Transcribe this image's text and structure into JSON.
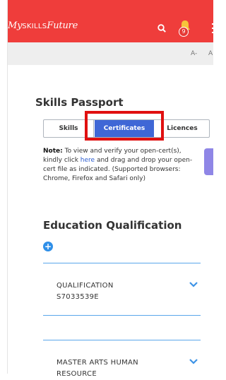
{
  "header": {
    "logo_prefix": "My",
    "logo_middle": "SKILLS",
    "logo_suffix": "Future",
    "notification_count": "9"
  },
  "font_controls": {
    "decrease": "A-",
    "increase": "A"
  },
  "page": {
    "title": "Skills Passport"
  },
  "tabs": [
    {
      "label": "Skills"
    },
    {
      "label": "Certificates",
      "active": true
    },
    {
      "label": "Licences"
    }
  ],
  "note": {
    "bold": "Note:",
    "part1": " To view and verify your open-cert(s), kindly click ",
    "link": "here",
    "part2": " and drag and drop your open-cert file as indicated. (Supported browsers: Chrome, Firefox and Safari only)"
  },
  "education": {
    "title": "Education Qualification",
    "add_symbol": "+",
    "items": [
      {
        "line1": "QUALIFICATION",
        "line2": "S7033539E"
      },
      {
        "line1": "MASTER ARTS HUMAN",
        "line2": "RESOURCE"
      }
    ]
  },
  "colors": {
    "brand": "#ef3d3b",
    "tab_active": "#3f67d6",
    "accent": "#2f8fe8"
  }
}
